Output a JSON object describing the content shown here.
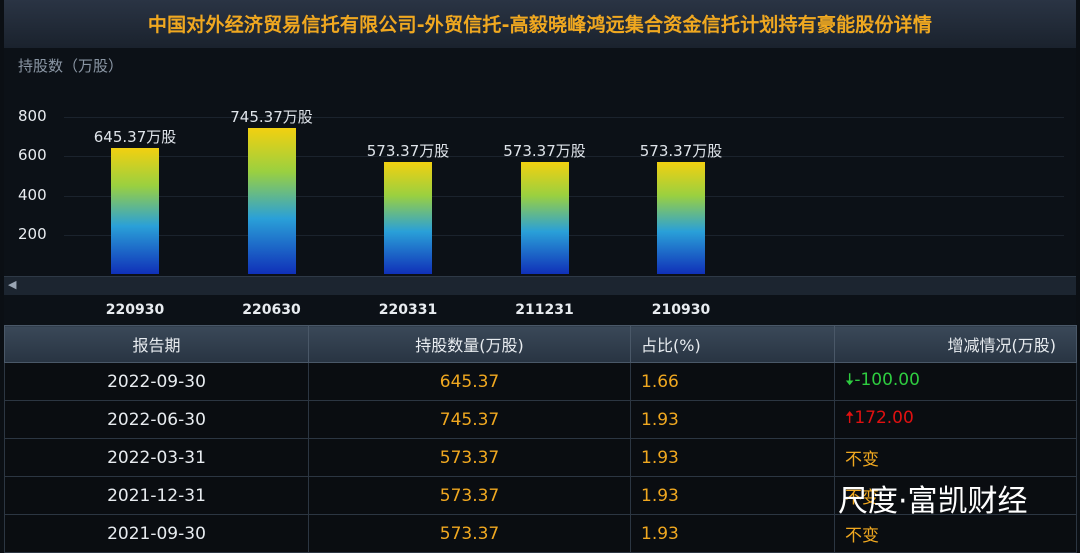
{
  "title": "中国对外经济贸易信托有限公司-外贸信托-高毅晓峰鸿远集合资金信托计划持有豪能股份详情",
  "chart_data": {
    "type": "bar",
    "ylabel": "持股数（万股）",
    "yticks": [
      200,
      400,
      600,
      800
    ],
    "ylim": [
      0,
      900
    ],
    "categories": [
      "220930",
      "220630",
      "220331",
      "211231",
      "210930"
    ],
    "values": [
      645.37,
      745.37,
      573.37,
      573.37,
      573.37
    ],
    "data_labels": [
      "645.37万股",
      "745.37万股",
      "573.37万股",
      "573.37万股",
      "573.37万股"
    ]
  },
  "table": {
    "headers": [
      "报告期",
      "持股数量(万股)",
      "占比(%)",
      "增减情况(万股)"
    ],
    "rows": [
      {
        "date": "2022-09-30",
        "shares": "645.37",
        "pct": "1.66",
        "change": "-100.00",
        "dir": "down",
        "arrow": "🠇"
      },
      {
        "date": "2022-06-30",
        "shares": "745.37",
        "pct": "1.93",
        "change": "172.00",
        "dir": "up",
        "arrow": "🠅"
      },
      {
        "date": "2022-03-31",
        "shares": "573.37",
        "pct": "1.93",
        "change": "不变",
        "dir": "flat",
        "arrow": ""
      },
      {
        "date": "2021-12-31",
        "shares": "573.37",
        "pct": "1.93",
        "change": "不变",
        "dir": "flat",
        "arrow": ""
      },
      {
        "date": "2021-09-30",
        "shares": "573.37",
        "pct": "1.93",
        "change": "不变",
        "dir": "flat",
        "arrow": ""
      }
    ]
  },
  "watermark": "尺度·富凯财经",
  "colors": {
    "accent": "#f0a820",
    "down": "#2ecc40",
    "up": "#e01010"
  }
}
